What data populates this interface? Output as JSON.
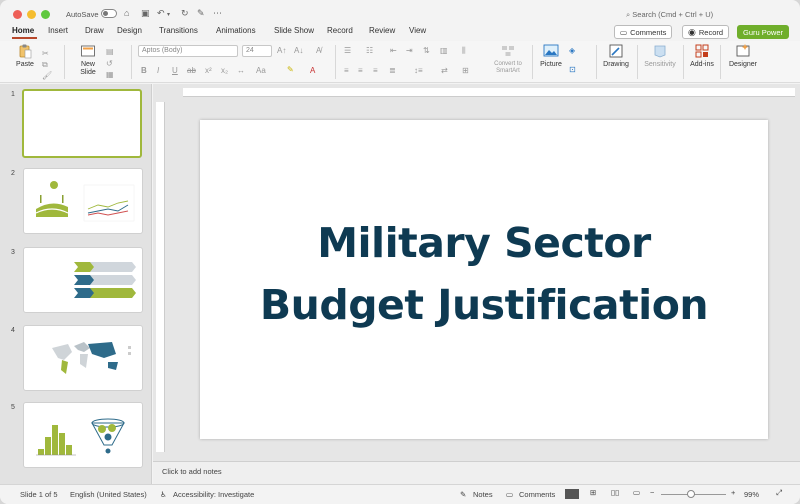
{
  "titlebar": {
    "autosave_label": "AutoSave",
    "search_placeholder": "Search (Cmd + Ctrl + U)",
    "more": "⋯"
  },
  "tabs": [
    {
      "label": "Home",
      "active": true
    },
    {
      "label": "Insert"
    },
    {
      "label": "Draw"
    },
    {
      "label": "Design"
    },
    {
      "label": "Transitions"
    },
    {
      "label": "Animations"
    },
    {
      "label": "Slide Show"
    },
    {
      "label": "Record"
    },
    {
      "label": "Review"
    },
    {
      "label": "View"
    }
  ],
  "tab_buttons": {
    "comments": "Comments",
    "record": "Record",
    "guru": "Guru Power"
  },
  "ribbon": {
    "paste": "Paste",
    "new_slide": "New\nSlide",
    "font_name": "Aptos (Body)",
    "font_size": "24",
    "convert": "Convert to\nSmartArt",
    "picture": "Picture",
    "drawing": "Drawing",
    "sensitivity": "Sensitivity",
    "addins": "Add-ins",
    "designer": "Designer"
  },
  "thumbnails": [
    "1",
    "2",
    "3",
    "4",
    "5"
  ],
  "slide": {
    "title_line1": "Military Sector",
    "title_line2": "Budget Justification"
  },
  "notes": {
    "placeholder": "Click to add notes"
  },
  "status": {
    "slide_count": "Slide 1 of 5",
    "language": "English (United States)",
    "accessibility": "Accessibility: Investigate",
    "notes": "Notes",
    "comments": "Comments",
    "zoom": "99%"
  },
  "colors": {
    "accent": "#b7472a",
    "title": "#0e3a52",
    "lime": "#a0b83c",
    "guru_green": "#6fae2b"
  }
}
